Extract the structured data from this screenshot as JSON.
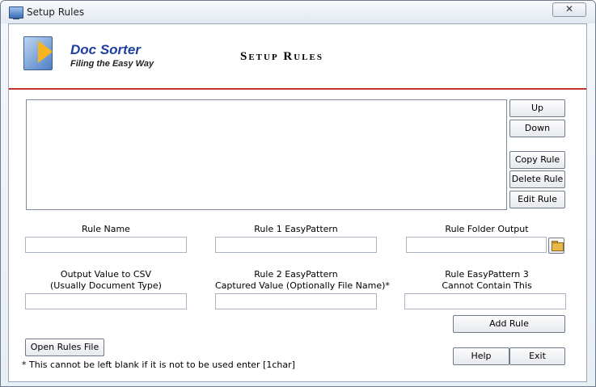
{
  "window": {
    "title": "Setup Rules",
    "close_label": "✕"
  },
  "logo": {
    "name": "Doc Sorter",
    "tagline": "Filing the Easy Way"
  },
  "heading": "Setup Rules",
  "rule_list": {
    "items": []
  },
  "side_buttons": {
    "up": "Up",
    "down": "Down",
    "copy": "Copy Rule",
    "delete": "Delete Rule",
    "edit": "Edit Rule"
  },
  "fields": {
    "rule_name": {
      "label": "Rule Name",
      "value": ""
    },
    "rule1_pattern": {
      "label": "Rule 1 EasyPattern",
      "value": ""
    },
    "folder_output": {
      "label": "Rule Folder Output",
      "value": ""
    },
    "output_csv": {
      "label_line1": "Output Value to CSV",
      "label_line2": "(Usually Document Type)",
      "value": ""
    },
    "rule2_pattern": {
      "label_line1": "Rule 2 EasyPattern",
      "label_line2": "Captured Value (Optionally File Name)*",
      "value": ""
    },
    "rule3_pattern": {
      "label_line1": "Rule EasyPattern 3",
      "label_line2": "Cannot Contain This",
      "value": ""
    }
  },
  "buttons": {
    "add_rule": "Add Rule",
    "open_rules_file": "Open Rules File",
    "help": "Help",
    "exit": "Exit"
  },
  "footnote": "* This cannot be left blank if it is not to be used enter  [1char]"
}
